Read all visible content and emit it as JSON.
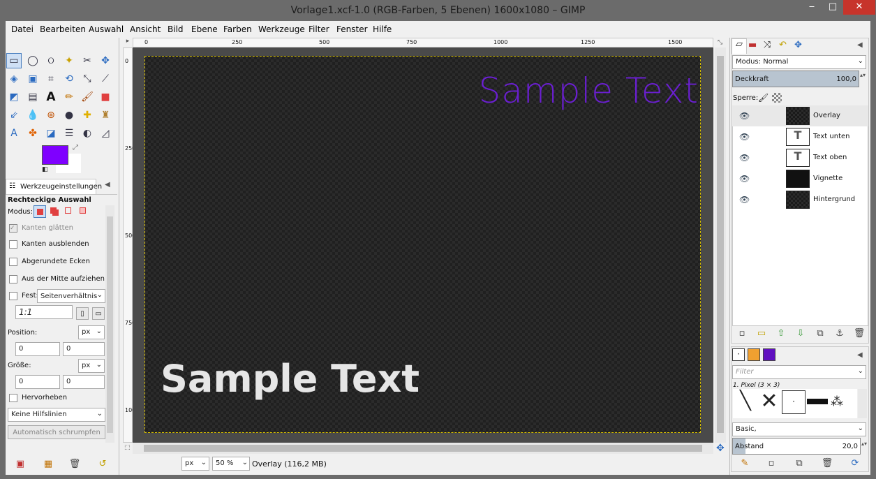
{
  "window": {
    "title": "Vorlage1.xcf-1.0 (RGB-Farben, 5 Ebenen) 1600x1080 – GIMP",
    "minimize": "‒",
    "maximize": "□",
    "close": "✕"
  },
  "menu": [
    "Datei",
    "Bearbeiten",
    "Auswahl",
    "Ansicht",
    "Bild",
    "Ebene",
    "Farben",
    "Werkzeuge",
    "Filter",
    "Fenster",
    "Hilfe"
  ],
  "toolbox": {
    "tools": [
      "rect-select",
      "ellipse-select",
      "free-select",
      "fuzzy-select",
      "scissors",
      "move",
      "paths",
      "align",
      "crop",
      "transform",
      "text",
      "pencil",
      "paintbrush",
      "eraser",
      "airbrush",
      "ink",
      "clone",
      "heal",
      "smudge",
      "dodge",
      "bucket",
      "blend",
      "color-picker",
      "measure"
    ],
    "fg_color": "#7f00ff",
    "bg_color": "#ffffff"
  },
  "tool_options": {
    "tab": "Werkzeugeinstellungen",
    "title": "Rechteckige Auswahl",
    "mode_label": "Modus:",
    "antialias": "Kanten glätten",
    "feather": "Kanten ausblenden",
    "rounded": "Abgerundete Ecken",
    "expand_center": "Aus der Mitte aufziehen",
    "fixed": "Fest:",
    "fixed_mode": "Seitenverhältnis",
    "ratio": "1:1",
    "position_label": "Position:",
    "position_unit": "px",
    "pos_x": "0",
    "pos_y": "0",
    "size_label": "Größe:",
    "size_unit": "px",
    "size_w": "0",
    "size_h": "0",
    "highlight": "Hervorheben",
    "guides": "Keine Hilfslinien",
    "autoshrink": "Automatisch schrumpfen"
  },
  "ruler": {
    "top": [
      "0",
      "250",
      "500",
      "750",
      "1000",
      "1250",
      "1500"
    ],
    "left": [
      "0",
      "250",
      "500",
      "750",
      "1000"
    ]
  },
  "canvas": {
    "text_top": "Sample Text",
    "text_top_color": "#6a1fd0",
    "text_bottom": "Sample Text",
    "text_bottom_color": "#e6e6e6"
  },
  "statusbar": {
    "unit": "px",
    "zoom": "50 %",
    "info": "Overlay (116,2 MB)"
  },
  "layers": {
    "mode_label": "Modus: Normal",
    "opacity_label": "Deckkraft",
    "opacity_value": "100,0",
    "lock_label": "Sperre:",
    "items": [
      {
        "name": "Overlay",
        "type": "raster"
      },
      {
        "name": "Text unten",
        "type": "text"
      },
      {
        "name": "Text oben",
        "type": "text"
      },
      {
        "name": "Vignette",
        "type": "raster"
      },
      {
        "name": "Hintergrund",
        "type": "raster"
      }
    ]
  },
  "brushes": {
    "filter_placeholder": "Filter",
    "current": "1. Pixel (3 × 3)",
    "tag": "Basic,",
    "spacing_label": "Abstand",
    "spacing_value": "20,0"
  }
}
